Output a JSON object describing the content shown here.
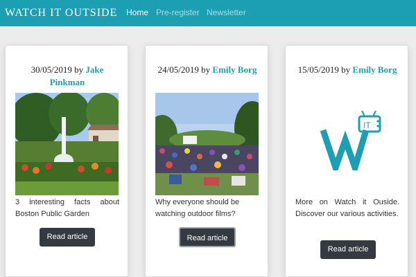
{
  "navbar": {
    "brand": "WATCH IT OUTSIDE",
    "links": [
      "Home",
      "Pre-register",
      "Newsletter"
    ]
  },
  "articles": [
    {
      "date": "30/05/2019",
      "by": "by",
      "author": "Jake Pinkman",
      "description": "3 interesting facts about Boston Public Garden",
      "button": "Read article"
    },
    {
      "date": "24/05/2019",
      "by": "by",
      "author": "Emily Borg",
      "description": "Why everyone should be watching outdoor films?",
      "button": "Read article"
    },
    {
      "date": "15/05/2019",
      "by": "by",
      "author": "Emily Borg",
      "description": "More on Watch it Ouside. Discover our various activities.",
      "button": "Read article",
      "logo_text": "IT"
    }
  ],
  "colors": {
    "accent": "#1c9fb3",
    "button": "#343a40"
  }
}
